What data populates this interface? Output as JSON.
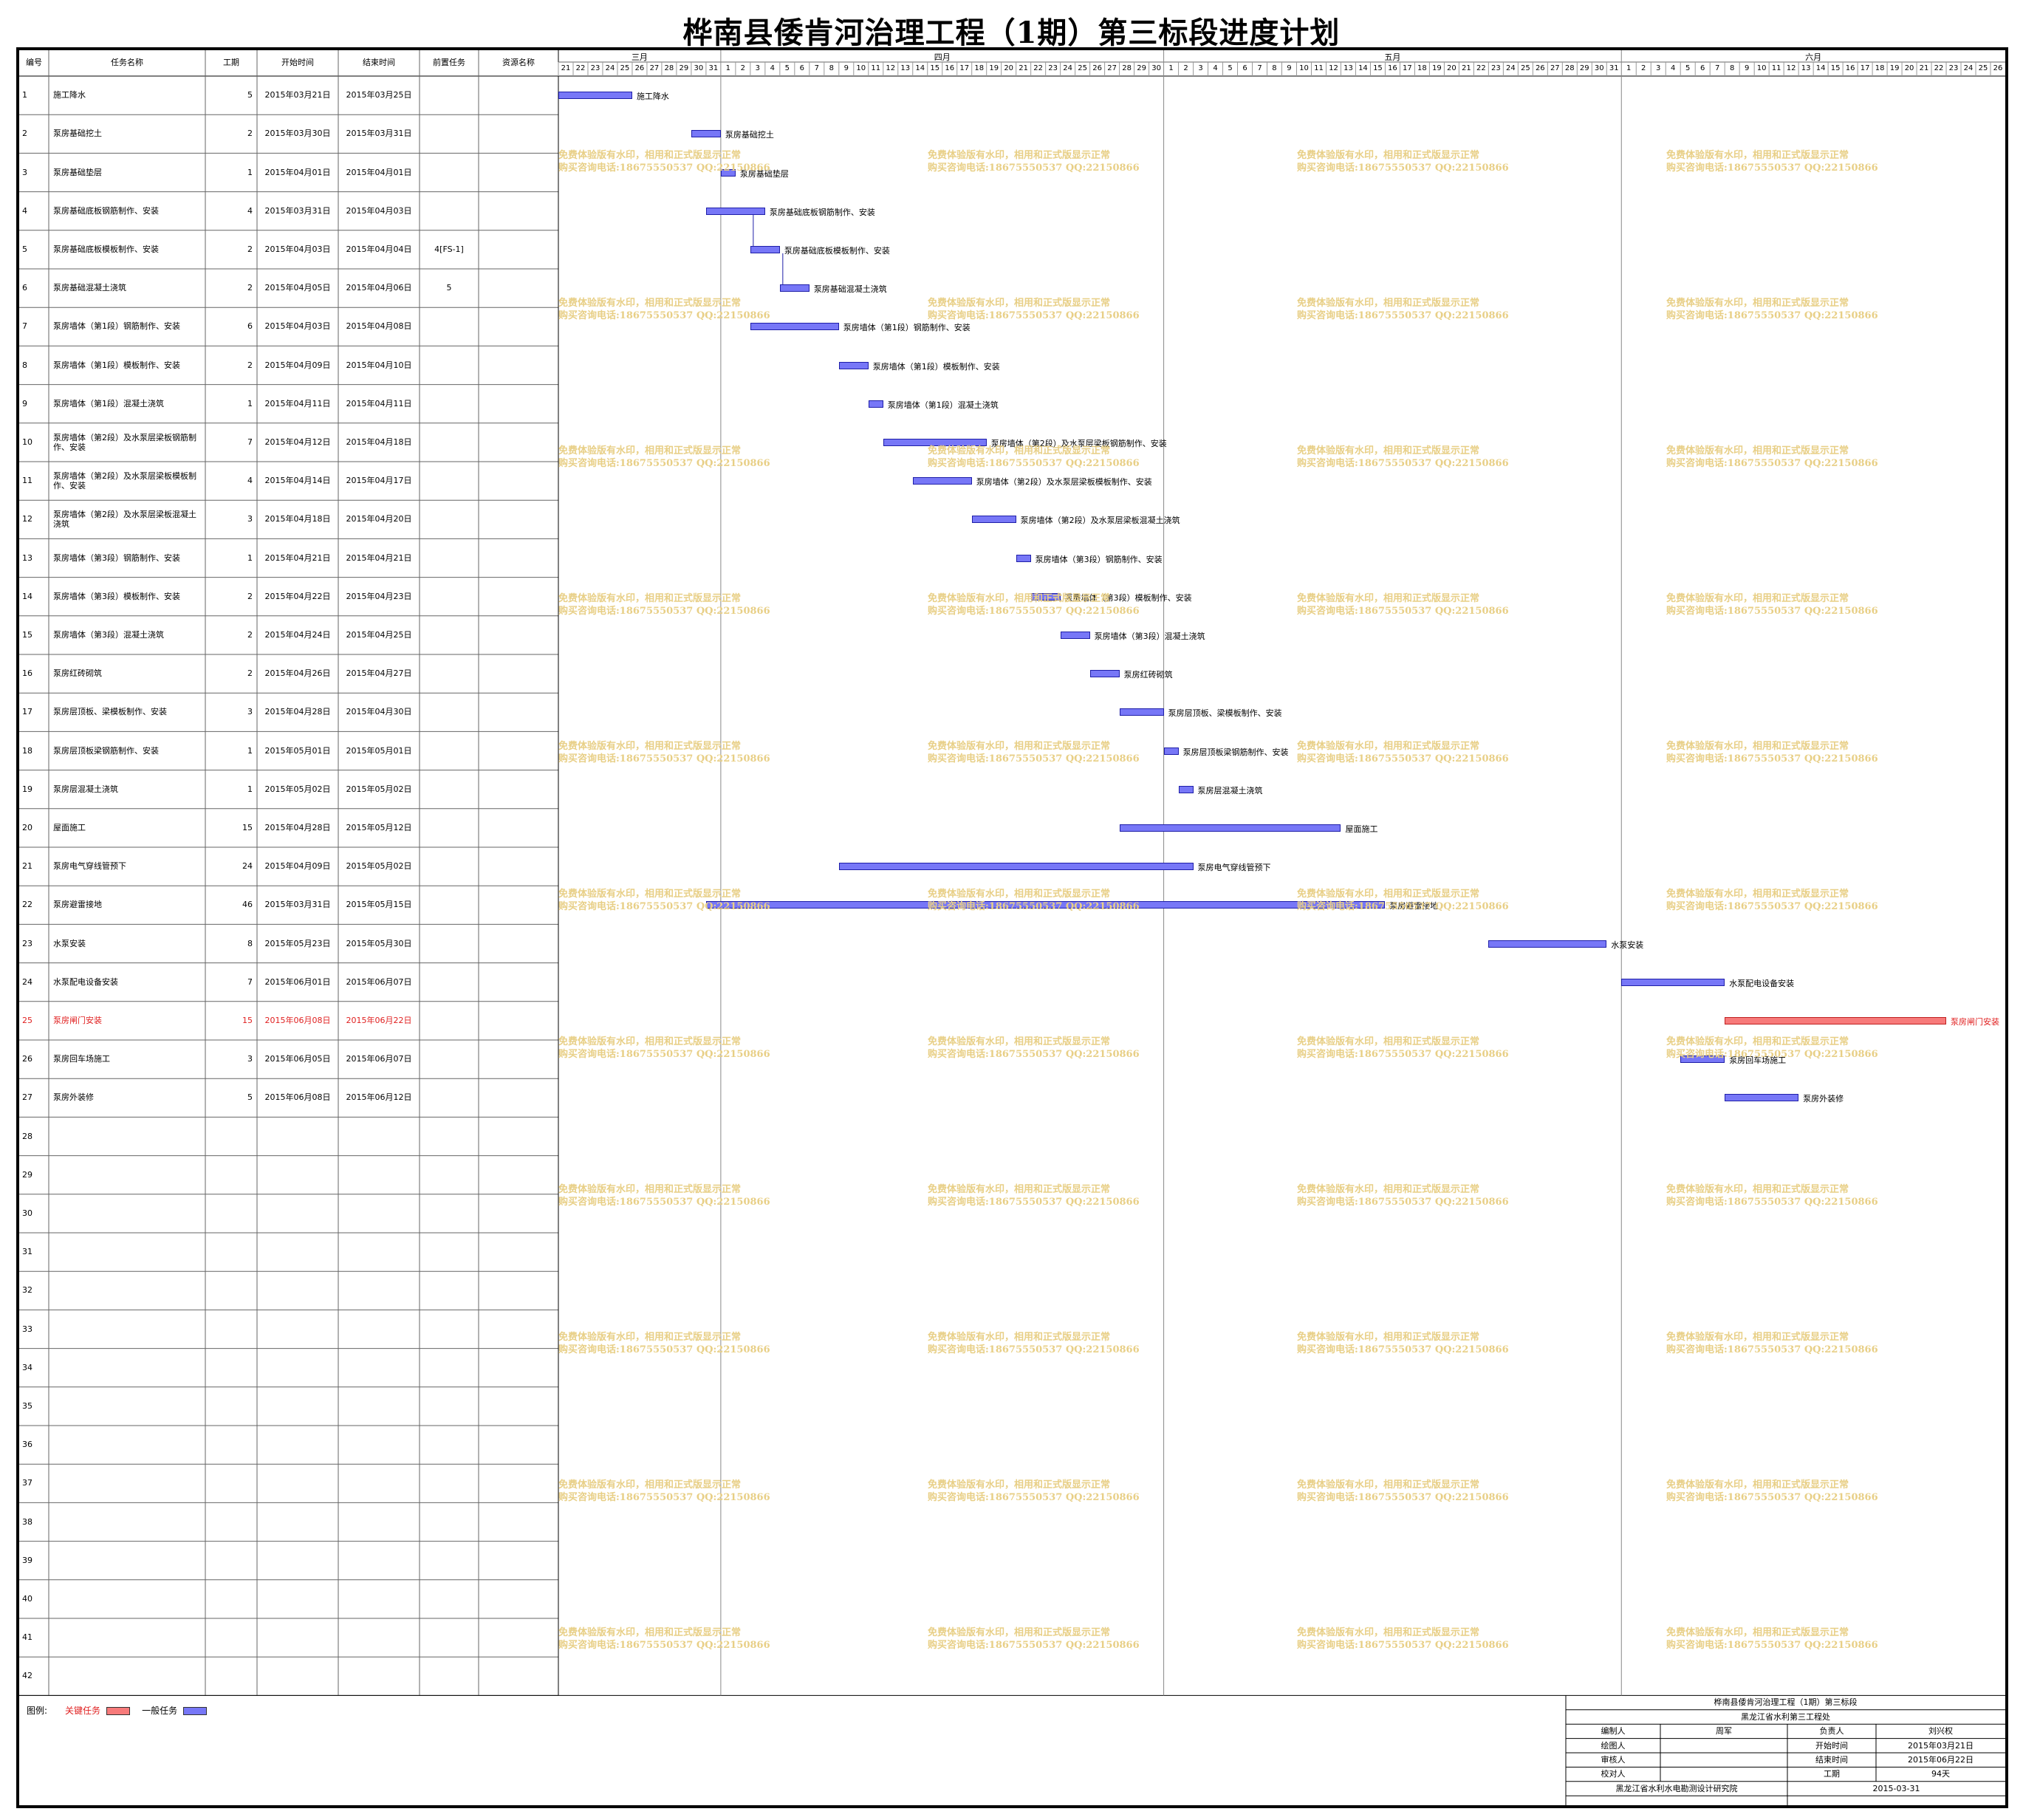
{
  "title": "桦南县倭肯河治理工程（1期）第三标段进度计划",
  "table_headers": {
    "id": "编号",
    "name": "任务名称",
    "duration": "工期",
    "start": "开始时间",
    "end": "结束时间",
    "pred": "前置任务",
    "resource": "资源名称"
  },
  "months": [
    {
      "label": "三月",
      "days": [
        "21",
        "22",
        "23",
        "24",
        "25",
        "26",
        "27",
        "28",
        "29",
        "30",
        "31"
      ]
    },
    {
      "label": "四月",
      "days": [
        "1",
        "2",
        "3",
        "4",
        "5",
        "6",
        "7",
        "8",
        "9",
        "10",
        "11",
        "12",
        "13",
        "14",
        "15",
        "16",
        "17",
        "18",
        "19",
        "20",
        "21",
        "22",
        "23",
        "24",
        "25",
        "26",
        "27",
        "28",
        "29",
        "30"
      ]
    },
    {
      "label": "五月",
      "days": [
        "1",
        "2",
        "3",
        "4",
        "5",
        "6",
        "7",
        "8",
        "9",
        "10",
        "11",
        "12",
        "13",
        "14",
        "15",
        "16",
        "17",
        "18",
        "19",
        "20",
        "21",
        "22",
        "23",
        "24",
        "25",
        "26",
        "27",
        "28",
        "29",
        "30",
        "31"
      ]
    },
    {
      "label": "六月",
      "days": [
        "1",
        "2",
        "3",
        "4",
        "5",
        "6",
        "7",
        "8",
        "9",
        "10",
        "11",
        "12",
        "13",
        "14",
        "15",
        "16",
        "17",
        "18",
        "19",
        "20",
        "21",
        "22",
        "23",
        "24",
        "25",
        "26"
      ]
    }
  ],
  "chart_data": {
    "type": "gantt",
    "start_date": "2015-03-21",
    "tasks": [
      {
        "id": "1",
        "name": "施工降水",
        "duration": "5",
        "start": "2015年03月21日",
        "end": "2015年03月25日",
        "pred": "",
        "critical": false,
        "s": "2015-03-21",
        "e": "2015-03-25"
      },
      {
        "id": "2",
        "name": "泵房基础挖土",
        "duration": "2",
        "start": "2015年03月30日",
        "end": "2015年03月31日",
        "pred": "",
        "critical": false,
        "s": "2015-03-30",
        "e": "2015-03-31"
      },
      {
        "id": "3",
        "name": "泵房基础垫层",
        "duration": "1",
        "start": "2015年04月01日",
        "end": "2015年04月01日",
        "pred": "",
        "critical": false,
        "s": "2015-04-01",
        "e": "2015-04-01"
      },
      {
        "id": "4",
        "name": "泵房基础底板钢筋制作、安装",
        "duration": "4",
        "start": "2015年03月31日",
        "end": "2015年04月03日",
        "pred": "",
        "critical": false,
        "s": "2015-03-31",
        "e": "2015-04-03"
      },
      {
        "id": "5",
        "name": "泵房基础底板模板制作、安装",
        "duration": "2",
        "start": "2015年04月03日",
        "end": "2015年04月04日",
        "pred": "4[FS-1]",
        "critical": false,
        "s": "2015-04-03",
        "e": "2015-04-04"
      },
      {
        "id": "6",
        "name": "泵房基础混凝土浇筑",
        "duration": "2",
        "start": "2015年04月05日",
        "end": "2015年04月06日",
        "pred": "5",
        "critical": false,
        "s": "2015-04-05",
        "e": "2015-04-06"
      },
      {
        "id": "7",
        "name": "泵房墙体（第1段）钢筋制作、安装",
        "duration": "6",
        "start": "2015年04月03日",
        "end": "2015年04月08日",
        "pred": "",
        "critical": false,
        "s": "2015-04-03",
        "e": "2015-04-08"
      },
      {
        "id": "8",
        "name": "泵房墙体（第1段）模板制作、安装",
        "duration": "2",
        "start": "2015年04月09日",
        "end": "2015年04月10日",
        "pred": "",
        "critical": false,
        "s": "2015-04-09",
        "e": "2015-04-10"
      },
      {
        "id": "9",
        "name": "泵房墙体（第1段）混凝土浇筑",
        "duration": "1",
        "start": "2015年04月11日",
        "end": "2015年04月11日",
        "pred": "",
        "critical": false,
        "s": "2015-04-11",
        "e": "2015-04-11"
      },
      {
        "id": "10",
        "name": "泵房墙体（第2段）及水泵层梁板钢筋制作、安装",
        "duration": "7",
        "start": "2015年04月12日",
        "end": "2015年04月18日",
        "pred": "",
        "critical": false,
        "s": "2015-04-12",
        "e": "2015-04-18"
      },
      {
        "id": "11",
        "name": "泵房墙体（第2段）及水泵层梁板模板制作、安装",
        "duration": "4",
        "start": "2015年04月14日",
        "end": "2015年04月17日",
        "pred": "",
        "critical": false,
        "s": "2015-04-14",
        "e": "2015-04-17"
      },
      {
        "id": "12",
        "name": "泵房墙体（第2段）及水泵层梁板混凝土浇筑",
        "duration": "3",
        "start": "2015年04月18日",
        "end": "2015年04月20日",
        "pred": "",
        "critical": false,
        "s": "2015-04-18",
        "e": "2015-04-20"
      },
      {
        "id": "13",
        "name": "泵房墙体（第3段）钢筋制作、安装",
        "duration": "1",
        "start": "2015年04月21日",
        "end": "2015年04月21日",
        "pred": "",
        "critical": false,
        "s": "2015-04-21",
        "e": "2015-04-21"
      },
      {
        "id": "14",
        "name": "泵房墙体（第3段）模板制作、安装",
        "duration": "2",
        "start": "2015年04月22日",
        "end": "2015年04月23日",
        "pred": "",
        "critical": false,
        "s": "2015-04-22",
        "e": "2015-04-23"
      },
      {
        "id": "15",
        "name": "泵房墙体（第3段）混凝土浇筑",
        "duration": "2",
        "start": "2015年04月24日",
        "end": "2015年04月25日",
        "pred": "",
        "critical": false,
        "s": "2015-04-24",
        "e": "2015-04-25"
      },
      {
        "id": "16",
        "name": "泵房红砖砌筑",
        "duration": "2",
        "start": "2015年04月26日",
        "end": "2015年04月27日",
        "pred": "",
        "critical": false,
        "s": "2015-04-26",
        "e": "2015-04-27"
      },
      {
        "id": "17",
        "name": "泵房层顶板、梁模板制作、安装",
        "duration": "3",
        "start": "2015年04月28日",
        "end": "2015年04月30日",
        "pred": "",
        "critical": false,
        "s": "2015-04-28",
        "e": "2015-04-30"
      },
      {
        "id": "18",
        "name": "泵房层顶板梁钢筋制作、安装",
        "duration": "1",
        "start": "2015年05月01日",
        "end": "2015年05月01日",
        "pred": "",
        "critical": false,
        "s": "2015-05-01",
        "e": "2015-05-01"
      },
      {
        "id": "19",
        "name": "泵房层混凝土浇筑",
        "duration": "1",
        "start": "2015年05月02日",
        "end": "2015年05月02日",
        "pred": "",
        "critical": false,
        "s": "2015-05-02",
        "e": "2015-05-02"
      },
      {
        "id": "20",
        "name": "屋面施工",
        "duration": "15",
        "start": "2015年04月28日",
        "end": "2015年05月12日",
        "pred": "",
        "critical": false,
        "s": "2015-04-28",
        "e": "2015-05-12"
      },
      {
        "id": "21",
        "name": "泵房电气穿线管预下",
        "duration": "24",
        "start": "2015年04月09日",
        "end": "2015年05月02日",
        "pred": "",
        "critical": false,
        "s": "2015-04-09",
        "e": "2015-05-02"
      },
      {
        "id": "22",
        "name": "泵房避雷接地",
        "duration": "46",
        "start": "2015年03月31日",
        "end": "2015年05月15日",
        "pred": "",
        "critical": false,
        "s": "2015-03-31",
        "e": "2015-05-15"
      },
      {
        "id": "23",
        "name": "水泵安装",
        "duration": "8",
        "start": "2015年05月23日",
        "end": "2015年05月30日",
        "pred": "",
        "critical": false,
        "s": "2015-05-23",
        "e": "2015-05-30"
      },
      {
        "id": "24",
        "name": "水泵配电设备安装",
        "duration": "7",
        "start": "2015年06月01日",
        "end": "2015年06月07日",
        "pred": "",
        "critical": false,
        "s": "2015-06-01",
        "e": "2015-06-07"
      },
      {
        "id": "25",
        "name": "泵房闸门安装",
        "duration": "15",
        "start": "2015年06月08日",
        "end": "2015年06月22日",
        "pred": "",
        "critical": true,
        "s": "2015-06-08",
        "e": "2015-06-22"
      },
      {
        "id": "26",
        "name": "泵房回车场施工",
        "duration": "3",
        "start": "2015年06月05日",
        "end": "2015年06月07日",
        "pred": "",
        "critical": false,
        "s": "2015-06-05",
        "e": "2015-06-07"
      },
      {
        "id": "27",
        "name": "泵房外装修",
        "duration": "5",
        "start": "2015年06月08日",
        "end": "2015年06月12日",
        "pred": "",
        "critical": false,
        "s": "2015-06-08",
        "e": "2015-06-12"
      }
    ]
  },
  "empty_rows": [
    "28",
    "29",
    "30",
    "31",
    "32",
    "33",
    "34",
    "35",
    "36",
    "37",
    "38",
    "39",
    "40",
    "41",
    "42"
  ],
  "watermark": {
    "line1": "免费体验版有水印，相用和正式版显示正常",
    "line2": "购买咨询电话:18675550537 QQ:22150866"
  },
  "legend": {
    "prefix": "图例:",
    "critical_label": "关键任务",
    "normal_label": "一般任务",
    "critical_color": "#f77a7a",
    "normal_color": "#7777f7"
  },
  "title_block": {
    "project": "桦南县倭肯河治理工程（1期）第三标段",
    "unit": "黑龙江省水利第三工程处",
    "rows": [
      {
        "k1": "编制人",
        "v1": "周军",
        "k2": "负责人",
        "v2": "刘兴权"
      },
      {
        "k1": "绘图人",
        "v1": "",
        "k2": "开始时间",
        "v2": "2015年03月21日"
      },
      {
        "k1": "审核人",
        "v1": "",
        "k2": "结束时间",
        "v2": "2015年06月22日"
      },
      {
        "k1": "校对人",
        "v1": "",
        "k2": "工期",
        "v2": "94天"
      }
    ],
    "institute": "黑龙江省水利水电勘测设计研究院",
    "date": "2015-03-31"
  }
}
